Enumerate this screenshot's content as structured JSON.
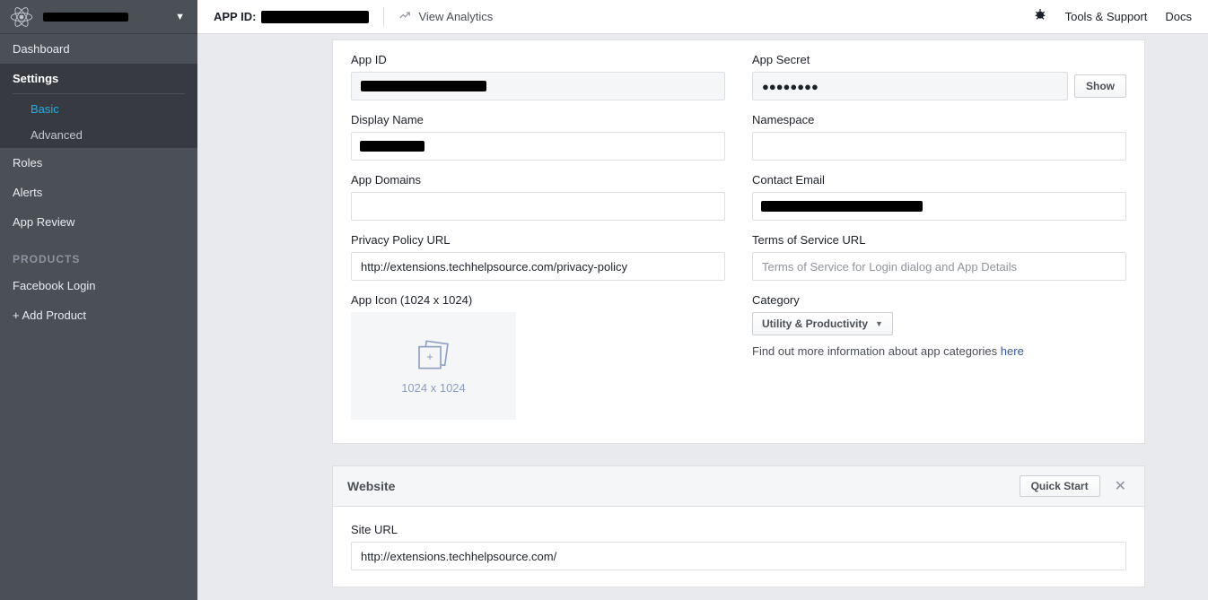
{
  "topbar": {
    "appid_label": "APP ID:",
    "view_analytics": "View Analytics",
    "tools_support": "Tools & Support",
    "docs": "Docs"
  },
  "sidebar": {
    "dashboard": "Dashboard",
    "settings": "Settings",
    "basic": "Basic",
    "advanced": "Advanced",
    "roles": "Roles",
    "alerts": "Alerts",
    "app_review": "App Review",
    "products_label": "PRODUCTS",
    "facebook_login": "Facebook Login",
    "add_product": "+ Add Product"
  },
  "form": {
    "app_id_label": "App ID",
    "app_secret_label": "App Secret",
    "app_secret_value": "●●●●●●●●",
    "show_btn": "Show",
    "display_name_label": "Display Name",
    "namespace_label": "Namespace",
    "namespace_value": "",
    "app_domains_label": "App Domains",
    "app_domains_value": "",
    "contact_email_label": "Contact Email",
    "privacy_label": "Privacy Policy URL",
    "privacy_value": "http://extensions.techhelpsource.com/privacy-policy",
    "tos_label": "Terms of Service URL",
    "tos_placeholder": "Terms of Service for Login dialog and App Details",
    "tos_value": "",
    "app_icon_label": "App Icon (1024 x 1024)",
    "icon_dim": "1024 x 1024",
    "category_label": "Category",
    "category_value": "Utility & Productivity",
    "category_note_text": "Find out more information about app categories ",
    "category_note_link": "here"
  },
  "platform": {
    "title": "Website",
    "quick_start": "Quick Start",
    "site_url_label": "Site URL",
    "site_url_value": "http://extensions.techhelpsource.com/"
  }
}
